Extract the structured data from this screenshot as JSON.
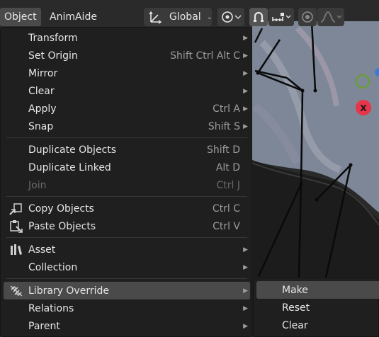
{
  "header": {
    "tabs": [
      {
        "label": "Object"
      },
      {
        "label": "AnimAide"
      }
    ],
    "orientation": {
      "label": "Global"
    }
  },
  "menu": {
    "items": [
      {
        "label": "Transform",
        "shortcut": "",
        "submenu": true,
        "icon": ""
      },
      {
        "label": "Set Origin",
        "shortcut": "Shift Ctrl Alt C",
        "submenu": true,
        "icon": ""
      },
      {
        "label": "Mirror",
        "shortcut": "",
        "submenu": true,
        "icon": ""
      },
      {
        "label": "Clear",
        "shortcut": "",
        "submenu": true,
        "icon": ""
      },
      {
        "label": "Apply",
        "shortcut": "Ctrl A",
        "submenu": true,
        "icon": ""
      },
      {
        "label": "Snap",
        "shortcut": "Shift S",
        "submenu": true,
        "icon": ""
      },
      {
        "label": "Duplicate Objects",
        "shortcut": "Shift D",
        "submenu": false,
        "icon": ""
      },
      {
        "label": "Duplicate Linked",
        "shortcut": "Alt D",
        "submenu": false,
        "icon": ""
      },
      {
        "label": "Join",
        "shortcut": "Ctrl J",
        "submenu": false,
        "icon": "",
        "disabled": true
      },
      {
        "label": "Copy Objects",
        "shortcut": "Ctrl C",
        "submenu": false,
        "icon": "copy-objects-icon"
      },
      {
        "label": "Paste Objects",
        "shortcut": "Ctrl V",
        "submenu": false,
        "icon": "paste-objects-icon"
      },
      {
        "label": "Asset",
        "shortcut": "",
        "submenu": true,
        "icon": "asset-icon"
      },
      {
        "label": "Collection",
        "shortcut": "",
        "submenu": true,
        "icon": ""
      },
      {
        "label": "Library Override",
        "shortcut": "",
        "submenu": true,
        "icon": "library-override-icon",
        "highlighted": true
      },
      {
        "label": "Relations",
        "shortcut": "",
        "submenu": true,
        "icon": ""
      },
      {
        "label": "Parent",
        "shortcut": "",
        "submenu": true,
        "icon": ""
      }
    ]
  },
  "submenu": {
    "items": [
      {
        "label": "Make",
        "highlighted": true
      },
      {
        "label": "Reset"
      },
      {
        "label": "Clear"
      }
    ]
  },
  "colors": {
    "menu_bg": "#1f1f1f",
    "highlight": "#4a4a4a",
    "text": "#e6e6e6",
    "shortcut": "#9c9c9c",
    "gizmo_x": "#e8354a",
    "gizmo_y": "#6a9c3a"
  }
}
